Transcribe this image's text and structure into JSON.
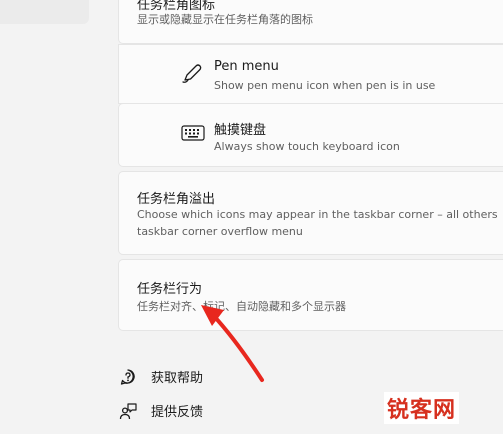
{
  "taskbar_corner_icons": {
    "title": "任务栏角图标",
    "description": "显示或隐藏显示在任务栏角落的图标"
  },
  "pen_menu": {
    "label": "Pen menu",
    "description": "Show pen menu icon when pen is in use",
    "icon": "pen-icon"
  },
  "touch_keyboard": {
    "label": "触摸键盘",
    "description": "Always show touch keyboard icon",
    "icon": "keyboard-icon"
  },
  "corner_overflow": {
    "title": "任务栏角溢出",
    "description_line1": "Choose which icons may appear in the taskbar corner – all others",
    "description_line2": "taskbar corner overflow menu"
  },
  "taskbar_behavior": {
    "title": "任务栏行为",
    "description": "任务栏对齐、标记、自动隐藏和多个显示器"
  },
  "footer": {
    "help": "获取帮助",
    "feedback": "提供反馈"
  },
  "annotation": {
    "arrow_color": "#e8271e"
  },
  "watermark": {
    "text": "锐客网"
  }
}
